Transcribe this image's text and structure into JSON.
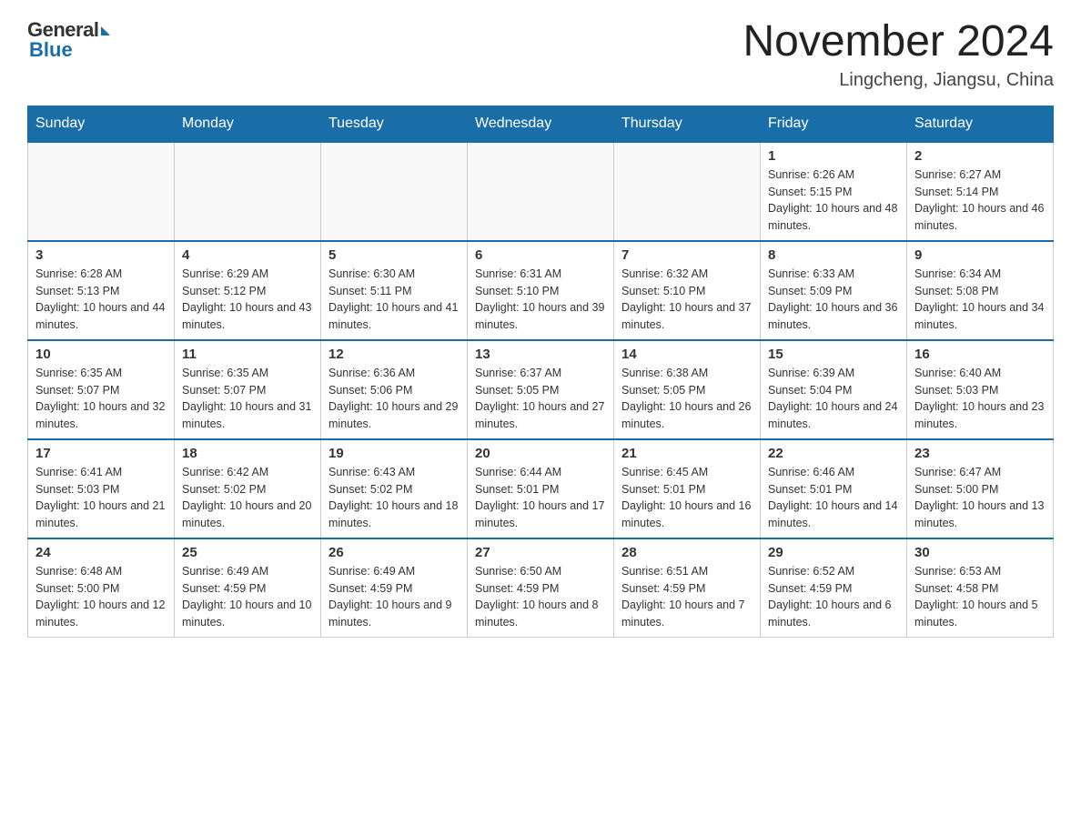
{
  "logo": {
    "general": "General",
    "blue": "Blue"
  },
  "title": "November 2024",
  "subtitle": "Lingcheng, Jiangsu, China",
  "days_of_week": [
    "Sunday",
    "Monday",
    "Tuesday",
    "Wednesday",
    "Thursday",
    "Friday",
    "Saturday"
  ],
  "weeks": [
    [
      null,
      null,
      null,
      null,
      null,
      {
        "day": "1",
        "sunrise": "Sunrise: 6:26 AM",
        "sunset": "Sunset: 5:15 PM",
        "daylight": "Daylight: 10 hours and 48 minutes."
      },
      {
        "day": "2",
        "sunrise": "Sunrise: 6:27 AM",
        "sunset": "Sunset: 5:14 PM",
        "daylight": "Daylight: 10 hours and 46 minutes."
      }
    ],
    [
      {
        "day": "3",
        "sunrise": "Sunrise: 6:28 AM",
        "sunset": "Sunset: 5:13 PM",
        "daylight": "Daylight: 10 hours and 44 minutes."
      },
      {
        "day": "4",
        "sunrise": "Sunrise: 6:29 AM",
        "sunset": "Sunset: 5:12 PM",
        "daylight": "Daylight: 10 hours and 43 minutes."
      },
      {
        "day": "5",
        "sunrise": "Sunrise: 6:30 AM",
        "sunset": "Sunset: 5:11 PM",
        "daylight": "Daylight: 10 hours and 41 minutes."
      },
      {
        "day": "6",
        "sunrise": "Sunrise: 6:31 AM",
        "sunset": "Sunset: 5:10 PM",
        "daylight": "Daylight: 10 hours and 39 minutes."
      },
      {
        "day": "7",
        "sunrise": "Sunrise: 6:32 AM",
        "sunset": "Sunset: 5:10 PM",
        "daylight": "Daylight: 10 hours and 37 minutes."
      },
      {
        "day": "8",
        "sunrise": "Sunrise: 6:33 AM",
        "sunset": "Sunset: 5:09 PM",
        "daylight": "Daylight: 10 hours and 36 minutes."
      },
      {
        "day": "9",
        "sunrise": "Sunrise: 6:34 AM",
        "sunset": "Sunset: 5:08 PM",
        "daylight": "Daylight: 10 hours and 34 minutes."
      }
    ],
    [
      {
        "day": "10",
        "sunrise": "Sunrise: 6:35 AM",
        "sunset": "Sunset: 5:07 PM",
        "daylight": "Daylight: 10 hours and 32 minutes."
      },
      {
        "day": "11",
        "sunrise": "Sunrise: 6:35 AM",
        "sunset": "Sunset: 5:07 PM",
        "daylight": "Daylight: 10 hours and 31 minutes."
      },
      {
        "day": "12",
        "sunrise": "Sunrise: 6:36 AM",
        "sunset": "Sunset: 5:06 PM",
        "daylight": "Daylight: 10 hours and 29 minutes."
      },
      {
        "day": "13",
        "sunrise": "Sunrise: 6:37 AM",
        "sunset": "Sunset: 5:05 PM",
        "daylight": "Daylight: 10 hours and 27 minutes."
      },
      {
        "day": "14",
        "sunrise": "Sunrise: 6:38 AM",
        "sunset": "Sunset: 5:05 PM",
        "daylight": "Daylight: 10 hours and 26 minutes."
      },
      {
        "day": "15",
        "sunrise": "Sunrise: 6:39 AM",
        "sunset": "Sunset: 5:04 PM",
        "daylight": "Daylight: 10 hours and 24 minutes."
      },
      {
        "day": "16",
        "sunrise": "Sunrise: 6:40 AM",
        "sunset": "Sunset: 5:03 PM",
        "daylight": "Daylight: 10 hours and 23 minutes."
      }
    ],
    [
      {
        "day": "17",
        "sunrise": "Sunrise: 6:41 AM",
        "sunset": "Sunset: 5:03 PM",
        "daylight": "Daylight: 10 hours and 21 minutes."
      },
      {
        "day": "18",
        "sunrise": "Sunrise: 6:42 AM",
        "sunset": "Sunset: 5:02 PM",
        "daylight": "Daylight: 10 hours and 20 minutes."
      },
      {
        "day": "19",
        "sunrise": "Sunrise: 6:43 AM",
        "sunset": "Sunset: 5:02 PM",
        "daylight": "Daylight: 10 hours and 18 minutes."
      },
      {
        "day": "20",
        "sunrise": "Sunrise: 6:44 AM",
        "sunset": "Sunset: 5:01 PM",
        "daylight": "Daylight: 10 hours and 17 minutes."
      },
      {
        "day": "21",
        "sunrise": "Sunrise: 6:45 AM",
        "sunset": "Sunset: 5:01 PM",
        "daylight": "Daylight: 10 hours and 16 minutes."
      },
      {
        "day": "22",
        "sunrise": "Sunrise: 6:46 AM",
        "sunset": "Sunset: 5:01 PM",
        "daylight": "Daylight: 10 hours and 14 minutes."
      },
      {
        "day": "23",
        "sunrise": "Sunrise: 6:47 AM",
        "sunset": "Sunset: 5:00 PM",
        "daylight": "Daylight: 10 hours and 13 minutes."
      }
    ],
    [
      {
        "day": "24",
        "sunrise": "Sunrise: 6:48 AM",
        "sunset": "Sunset: 5:00 PM",
        "daylight": "Daylight: 10 hours and 12 minutes."
      },
      {
        "day": "25",
        "sunrise": "Sunrise: 6:49 AM",
        "sunset": "Sunset: 4:59 PM",
        "daylight": "Daylight: 10 hours and 10 minutes."
      },
      {
        "day": "26",
        "sunrise": "Sunrise: 6:49 AM",
        "sunset": "Sunset: 4:59 PM",
        "daylight": "Daylight: 10 hours and 9 minutes."
      },
      {
        "day": "27",
        "sunrise": "Sunrise: 6:50 AM",
        "sunset": "Sunset: 4:59 PM",
        "daylight": "Daylight: 10 hours and 8 minutes."
      },
      {
        "day": "28",
        "sunrise": "Sunrise: 6:51 AM",
        "sunset": "Sunset: 4:59 PM",
        "daylight": "Daylight: 10 hours and 7 minutes."
      },
      {
        "day": "29",
        "sunrise": "Sunrise: 6:52 AM",
        "sunset": "Sunset: 4:59 PM",
        "daylight": "Daylight: 10 hours and 6 minutes."
      },
      {
        "day": "30",
        "sunrise": "Sunrise: 6:53 AM",
        "sunset": "Sunset: 4:58 PM",
        "daylight": "Daylight: 10 hours and 5 minutes."
      }
    ]
  ]
}
